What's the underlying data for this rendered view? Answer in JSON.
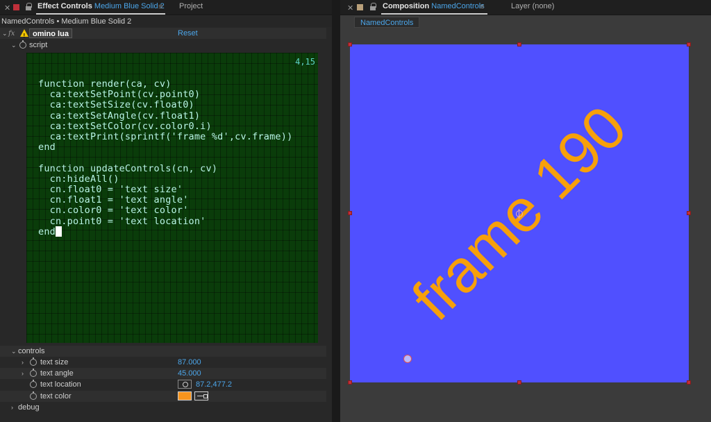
{
  "effect_controls": {
    "tab_title": "Effect Controls",
    "tab_subtitle": "Medium Blue Solid 2",
    "other_tab": "Project",
    "breadcrumb": "NamedControls • Medium Blue Solid 2",
    "effect_name": "omino lua",
    "reset_label": "Reset",
    "fx_label": "fx",
    "script_label": "script",
    "editor_position": "4,15",
    "code": "function render(ca, cv)\n  ca:textSetPoint(cv.point0)\n  ca:textSetSize(cv.float0)\n  ca:textSetAngle(cv.float1)\n  ca:textSetColor(cv.color0.i)\n  ca:textPrint(sprintf('frame %d',cv.frame))\nend\n\nfunction updateControls(cn, cv)\n  cn:hideAll()\n  cn.float0 = 'text size'\n  cn.float1 = 'text angle'\n  cn.color0 = 'text color'\n  cn.point0 = 'text location'\nend",
    "controls_label": "controls",
    "controls": [
      {
        "label": "text size",
        "value": "87.000"
      },
      {
        "label": "text angle",
        "value": "45.000"
      },
      {
        "label": "text location",
        "value": "87.2,477.2"
      },
      {
        "label": "text color",
        "value": ""
      }
    ],
    "debug_label": "debug",
    "text_color_hex": "#f7941d"
  },
  "composition": {
    "tab_title": "Composition",
    "tab_subtitle": "NamedControls",
    "layer_tab": "Layer (none)",
    "comp_chip": "NamedControls",
    "canvas_text": "frame 190",
    "canvas_color": "#5050ff",
    "text_color": "#f7a00a"
  }
}
